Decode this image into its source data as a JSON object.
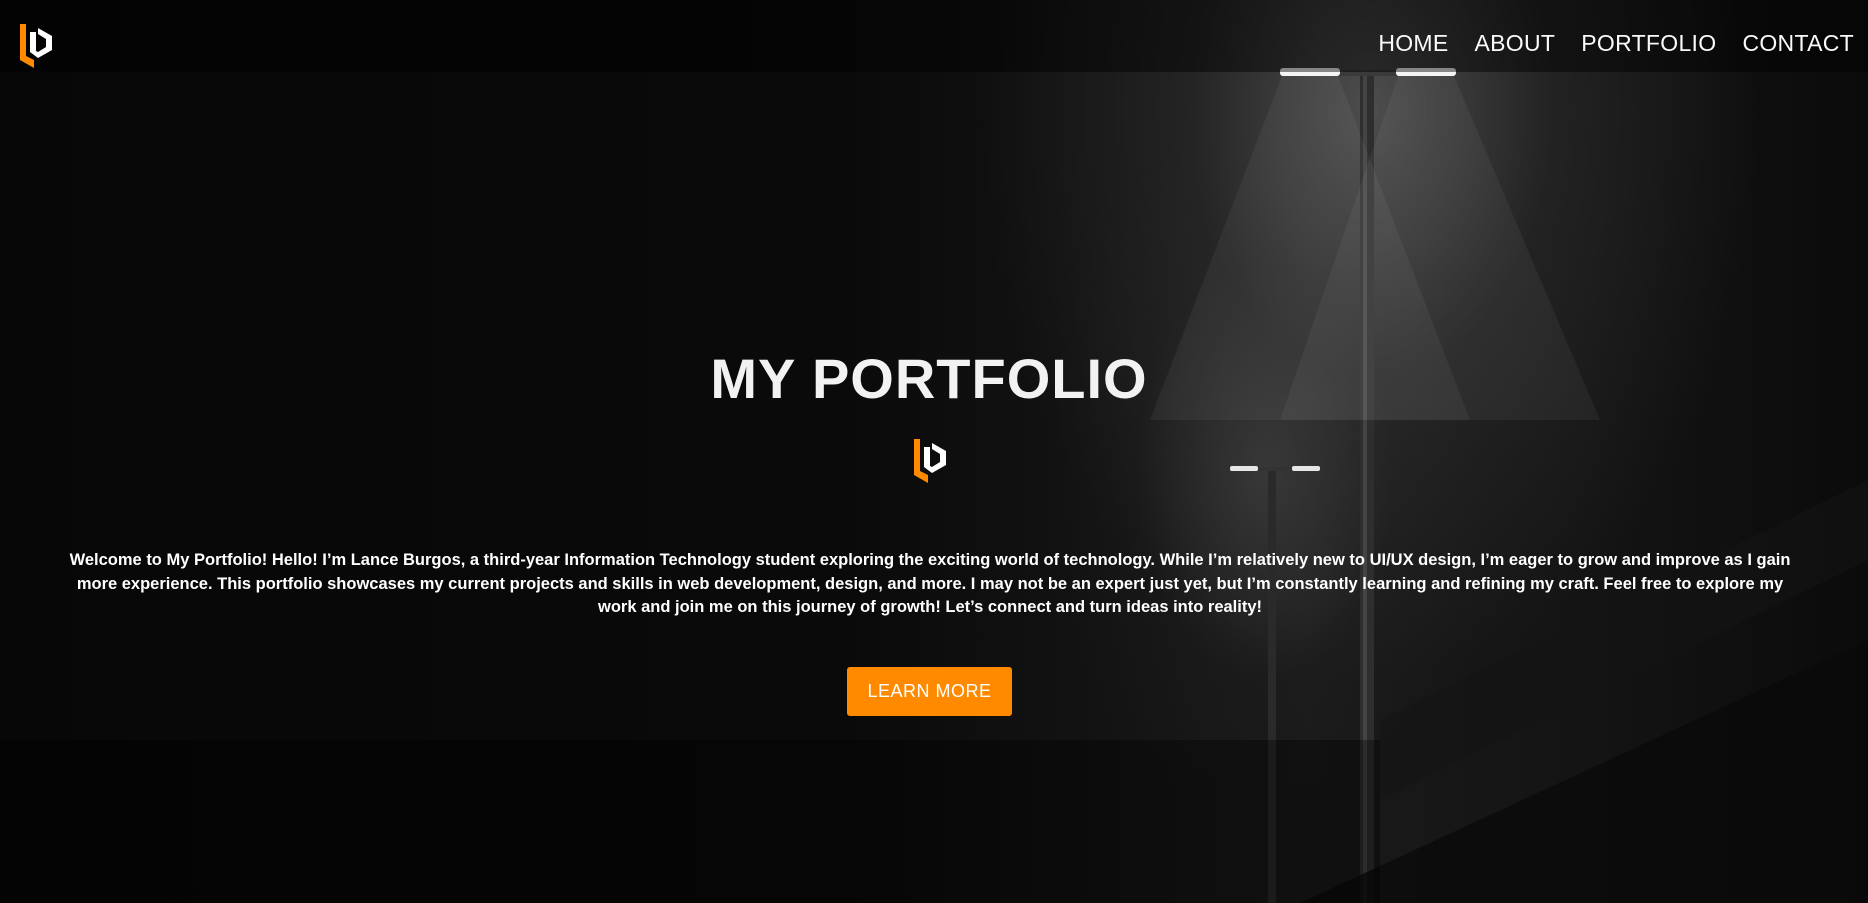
{
  "colors": {
    "accent": "#ff8a00",
    "text": "#ffffff",
    "background": "#050505"
  },
  "header": {
    "logo_icon": "lb-monogram-logo",
    "nav": [
      {
        "label": "HOME"
      },
      {
        "label": "ABOUT"
      },
      {
        "label": "PORTFOLIO"
      },
      {
        "label": "CONTACT"
      }
    ]
  },
  "hero": {
    "title": "MY PORTFOLIO",
    "logo_icon": "lb-monogram-logo",
    "intro": "Welcome to My Portfolio! Hello! I’m Lance Burgos, a third-year Information Technology student exploring the exciting world of technology. While I’m relatively new to UI/UX design, I’m eager to grow and improve as I gain more experience. This portfolio showcases my current projects and skills in web development, design, and more. I may not be an expert just yet, but I’m constantly learning and refining my craft. Feel free to explore my work and join me on this journey of growth! Let’s connect and turn ideas into reality!",
    "cta_label": "LEARN MORE"
  }
}
